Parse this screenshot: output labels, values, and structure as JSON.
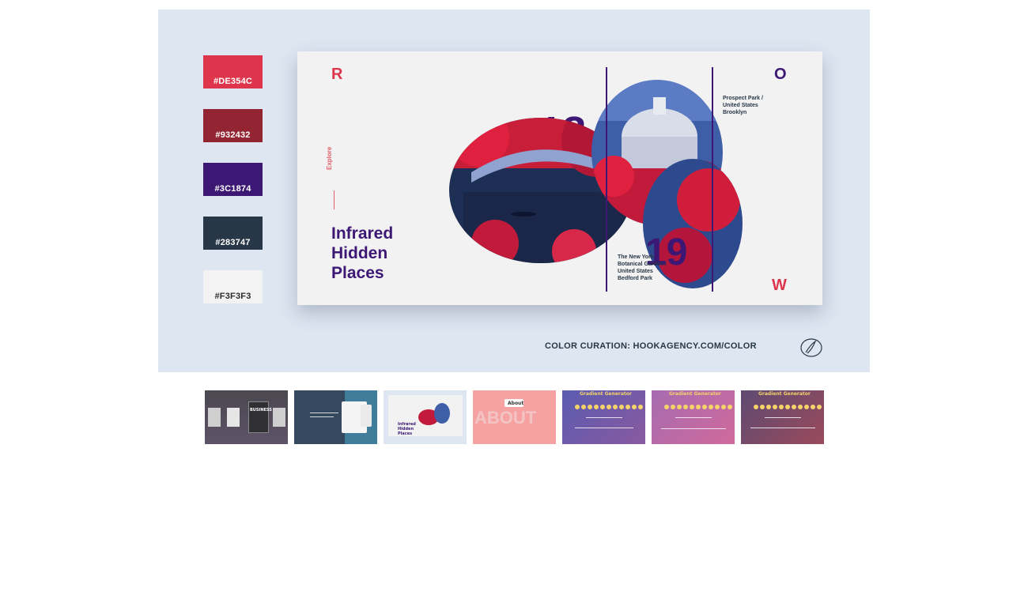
{
  "swatches": [
    {
      "label": "#DE354C",
      "color": "#DE354C"
    },
    {
      "label": "#932432",
      "color": "#932432"
    },
    {
      "label": "#3C1874",
      "color": "#3C1874"
    },
    {
      "label": "#283747",
      "color": "#283747"
    },
    {
      "label": "#F3F3F3",
      "color": "#F3F3F3"
    }
  ],
  "poster": {
    "letters": {
      "top_left": "R",
      "top_right": "O",
      "bottom_right": "W"
    },
    "explore": "Explore",
    "title_lines": [
      "Infrared",
      "Hidden",
      "Places"
    ],
    "numbers": {
      "top": "18",
      "bottom": "19"
    },
    "caption_right": "Prospect Park /\nUnited States\nBrooklyn",
    "caption_left": "The New York\nBotanical Garden /\nUnited States\nBedford Park"
  },
  "credit": "COLOR CURATION: HOOKAGENCY.COM/COLOR",
  "thumbnails": [
    {
      "name": "business-cards",
      "bg": "#4f4b55",
      "text": "BUSINESS"
    },
    {
      "name": "device-mockup",
      "bg": "#3f7d9a",
      "text": ""
    },
    {
      "name": "infrared-poster",
      "bg": "#dde6f1",
      "text": "Infrared Hidden Places"
    },
    {
      "name": "about-page",
      "bg": "#f7a2a2",
      "text": "ABOUT",
      "badge": "About"
    },
    {
      "name": "gradient-generator-1",
      "bg": "#6e5aa8",
      "text": "Gradient Generator"
    },
    {
      "name": "gradient-generator-2",
      "bg": "#b86aa6",
      "text": "Gradient Generator"
    },
    {
      "name": "gradient-generator-3",
      "bg": "#7a4a6a",
      "text": "Gradient Generator"
    }
  ]
}
